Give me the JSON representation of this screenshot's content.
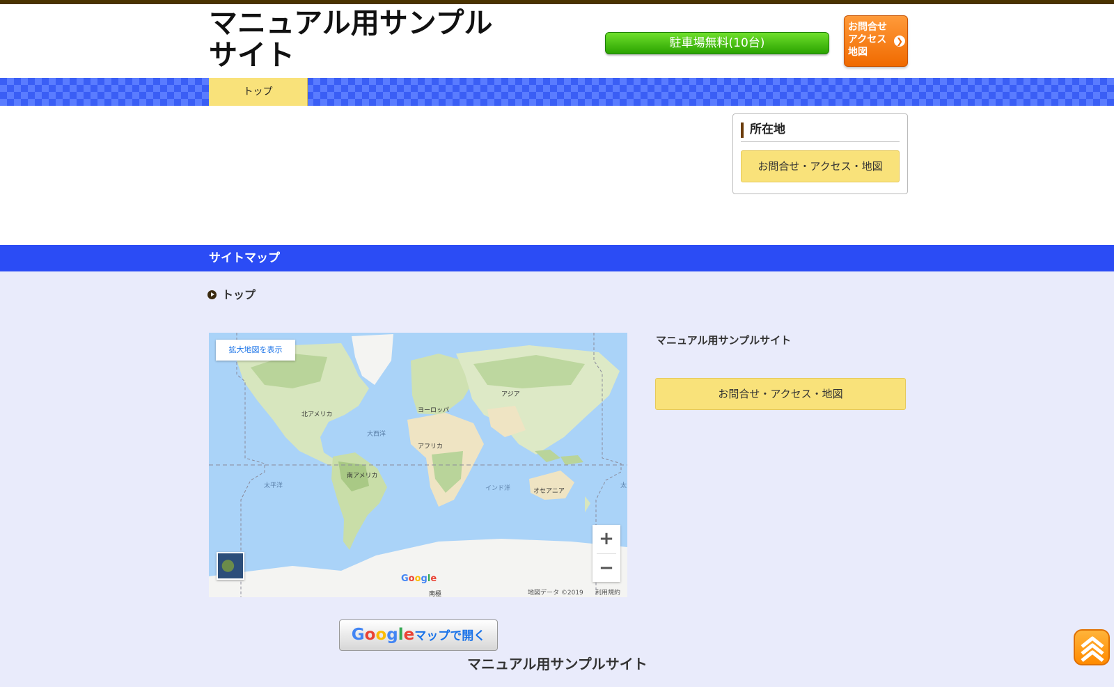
{
  "header": {
    "site_title": "マニュアル用サンプルサイト",
    "parking_label": "駐車場無料(10台)",
    "contact_lines": [
      "お問合せ",
      "アクセス",
      "地図"
    ],
    "contact_arrow": "❯",
    "accent_color": "#3a5ef5"
  },
  "nav": {
    "items": [
      {
        "label": "トップ",
        "active": true
      }
    ]
  },
  "sidebar": {
    "heading": "所在地",
    "link_label": "お問合せ・アクセス・地図"
  },
  "footer": {
    "sitemap_title": "サイトマップ",
    "breadcrumb_items": [
      "トップ"
    ],
    "site_name": "マニュアル用サンプルサイト",
    "link_label": "お問合せ・アクセス・地図",
    "gmap_button": {
      "brand": "Google",
      "text": "マップで開く"
    },
    "copyright": "マニュアル用サンプルサイト"
  },
  "map": {
    "enlarge_label": "拡大地図を表示",
    "labels": {
      "north_america": "北アメリカ",
      "south_america": "南アメリカ",
      "europe": "ヨーロッパ",
      "asia": "アジア",
      "africa": "アフリカ",
      "oceania": "オセアニア",
      "atlantic": "大西洋",
      "pacific": "太平洋",
      "indian": "インド洋",
      "pacific_edge": "太",
      "antarctica": "南極"
    },
    "zoom_in": "+",
    "zoom_out": "−",
    "google_logo": "Google",
    "attribution": "地図データ ©2019",
    "terms": "利用規約"
  }
}
